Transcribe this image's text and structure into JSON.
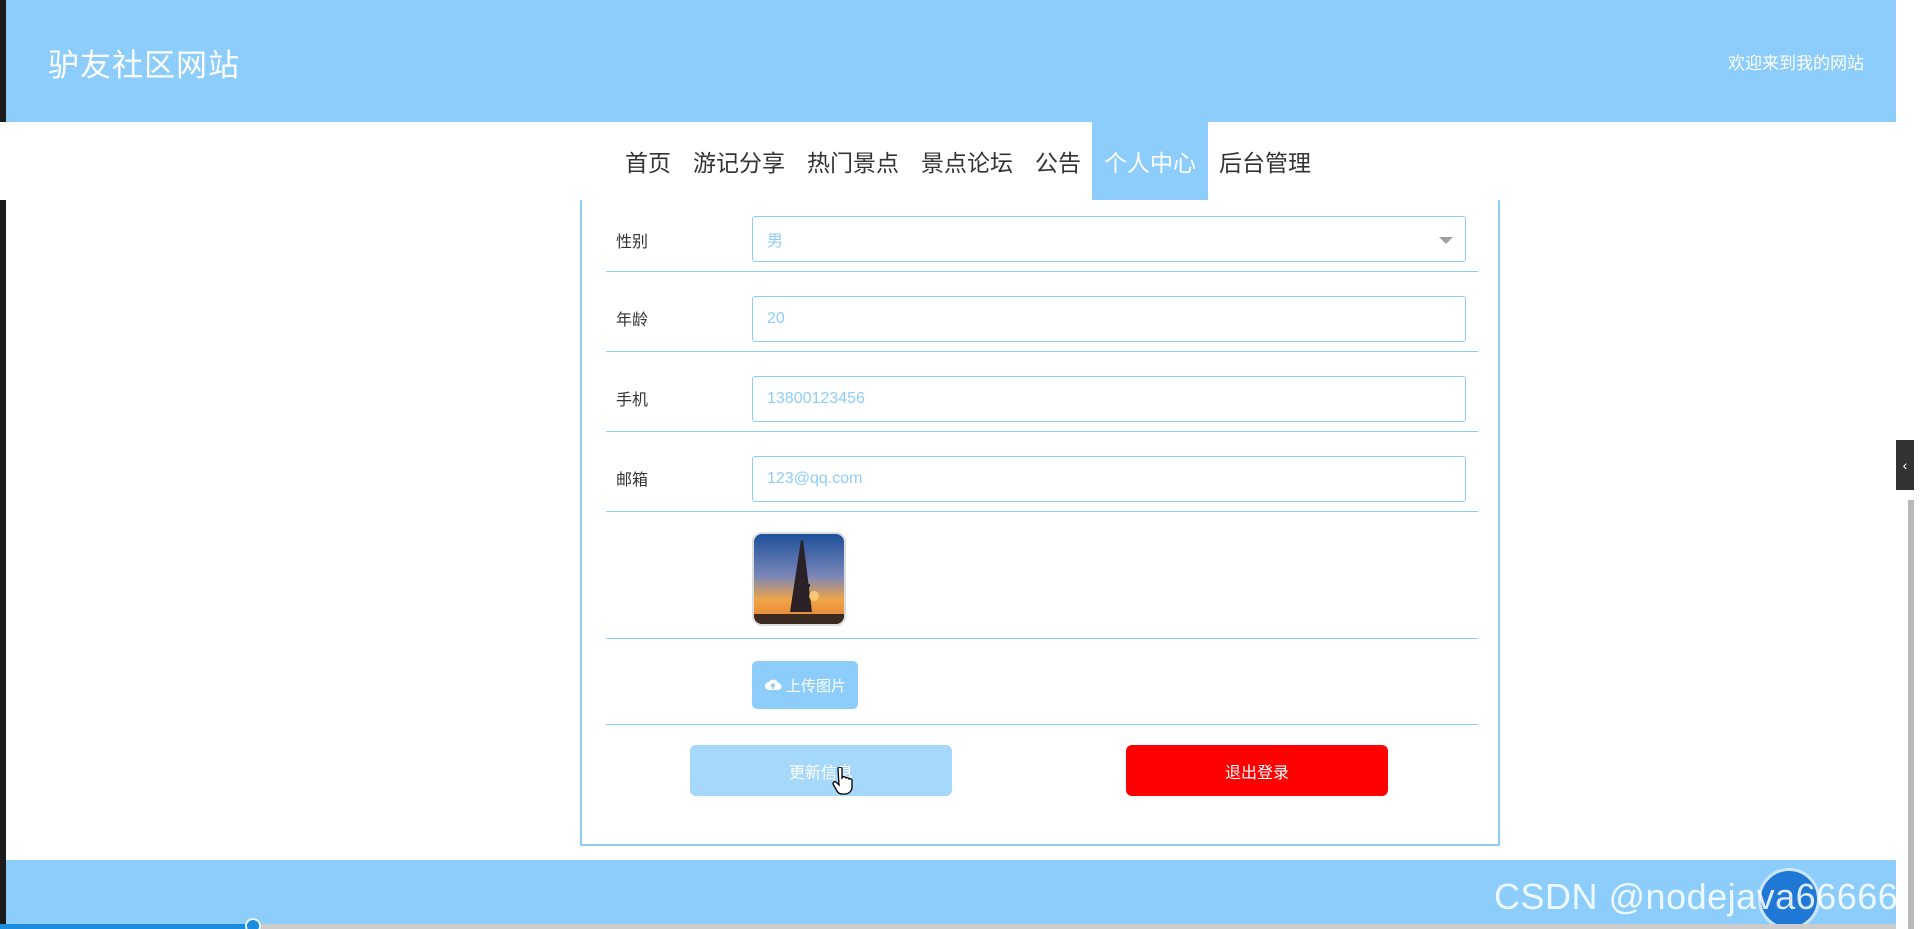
{
  "header": {
    "site_title": "驴友社区网站",
    "welcome_text": "欢迎来到我的网站"
  },
  "nav": {
    "items": [
      {
        "label": "首页",
        "active": false
      },
      {
        "label": "游记分享",
        "active": false
      },
      {
        "label": "热门景点",
        "active": false
      },
      {
        "label": "景点论坛",
        "active": false
      },
      {
        "label": "公告",
        "active": false
      },
      {
        "label": "个人中心",
        "active": true
      },
      {
        "label": "后台管理",
        "active": false
      }
    ]
  },
  "form": {
    "gender": {
      "label": "性别",
      "value": "男"
    },
    "age": {
      "label": "年龄",
      "value": "20"
    },
    "phone": {
      "label": "手机",
      "value": "13800123456"
    },
    "email": {
      "label": "邮箱",
      "value": "123@qq.com"
    },
    "upload_label": "上传图片",
    "update_button": "更新信息",
    "logout_button": "退出登录"
  },
  "watermark": "CSDN @nodejava666666",
  "video": {
    "progress_percent": 13
  },
  "colors": {
    "accent": "#8ccdfb",
    "danger": "#ff0000",
    "update_button": "#a6d8fb"
  }
}
